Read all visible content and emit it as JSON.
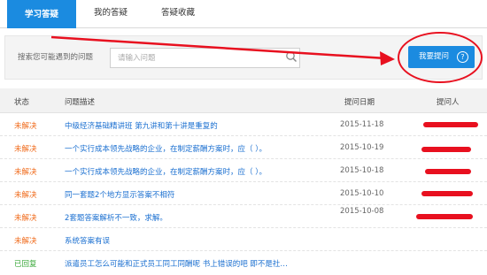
{
  "tabs": [
    {
      "label": "学习答疑",
      "active": true
    },
    {
      "label": "我的答疑",
      "active": false
    },
    {
      "label": "答疑收藏",
      "active": false
    }
  ],
  "search": {
    "label": "搜索您可能遇到的问题",
    "placeholder": "请输入问题"
  },
  "ask_button": {
    "label": "我要提问",
    "help_glyph": "?"
  },
  "table": {
    "headers": {
      "status": "状态",
      "question": "问题描述",
      "date": "提问日期",
      "asker": "提问人"
    },
    "rows": [
      {
        "status": "未解决",
        "status_type": "unsolved",
        "question": "中级经济基础精讲班 第九讲和第十讲是重复的",
        "date": "2015-11-18"
      },
      {
        "status": "未解决",
        "status_type": "unsolved",
        "question": "一个实行成本领先战略的企业，在制定薪酬方案时，应（ ）。",
        "date": "2015-10-19"
      },
      {
        "status": "未解决",
        "status_type": "unsolved",
        "question": "一个实行成本领先战略的企业，在制定薪酬方案时，应（ ）。",
        "date": "2015-10-18"
      },
      {
        "status": "未解决",
        "status_type": "unsolved",
        "question": "同一套题2个地方显示答案不相符",
        "date": "2015-10-10"
      },
      {
        "status": "未解决",
        "status_type": "unsolved",
        "question": "2套题答案解析不一致，求解。",
        "date": "2015-10-08"
      },
      {
        "status": "未解决",
        "status_type": "unsolved",
        "question": "系统答案有误",
        "date": ""
      },
      {
        "status": "已回复",
        "status_type": "solved",
        "question": "派遣员工怎么可能和正式员工同工同酬呢 书上错误的吧 即不是社…",
        "date": ""
      }
    ]
  },
  "colors": {
    "accent": "#1b8be0",
    "annotation_red": "#e8101f",
    "unsolved": "#f06a1a",
    "solved": "#3aa83a",
    "link": "#1a6fd0"
  }
}
